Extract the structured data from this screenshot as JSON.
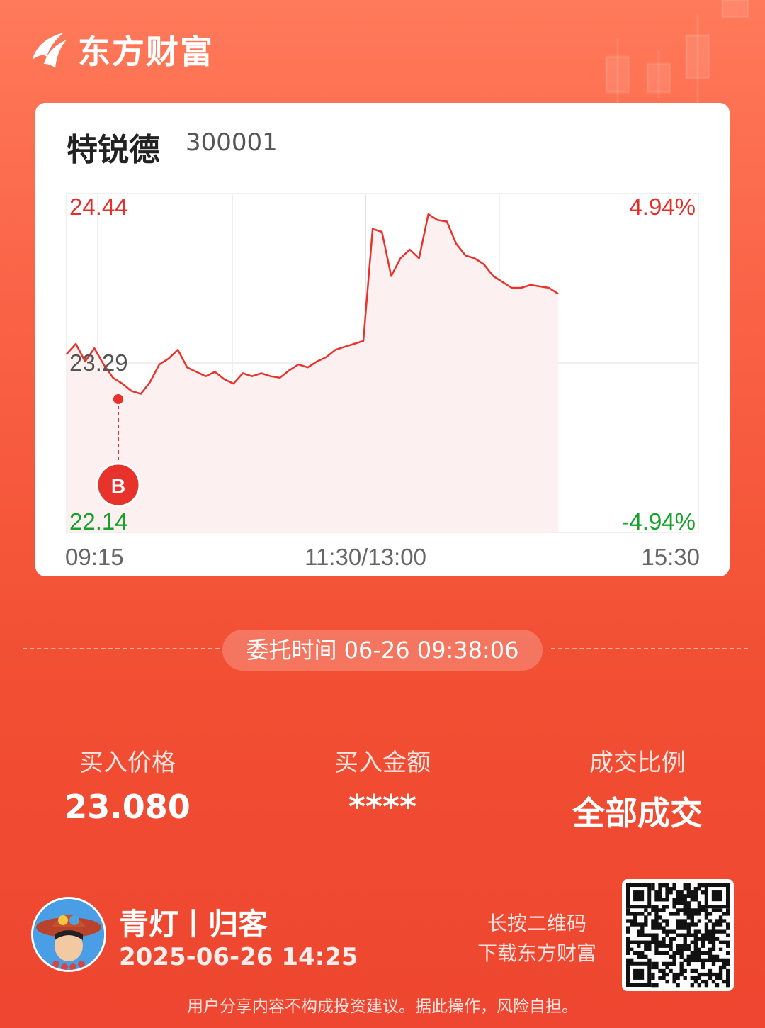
{
  "brand": {
    "name": "东方财富"
  },
  "stock": {
    "name": "特锐德",
    "code": "300001"
  },
  "chart": {
    "price_high": "24.44",
    "price_mid": "23.29",
    "price_low": "22.14",
    "pct_high": "4.94%",
    "pct_low": "-4.94%",
    "time_start": "09:15",
    "time_mid": "11:30/13:00",
    "time_end": "15:30",
    "buy_marker": "B",
    "colors": {
      "line": "#e8332c",
      "up": "#e3302a",
      "down": "#17a12a",
      "fill": "#fdeeee"
    }
  },
  "chart_data": {
    "type": "line",
    "title": "",
    "xlabel": "",
    "ylabel": "",
    "x_ticks": [
      "09:15",
      "11:30/13:00",
      "15:30"
    ],
    "ylim": [
      22.14,
      24.44
    ],
    "y_ticks": [
      22.14,
      23.29,
      24.44
    ],
    "series": [
      {
        "values": [
          23.35,
          23.42,
          23.3,
          23.39,
          23.28,
          23.19,
          23.15,
          23.1,
          23.08,
          23.16,
          23.28,
          23.32,
          23.38,
          23.26,
          23.23,
          23.2,
          23.23,
          23.18,
          23.15,
          23.22,
          23.2,
          23.22,
          23.2,
          23.19,
          23.24,
          23.28,
          23.26,
          23.3,
          23.33,
          23.38,
          23.4,
          23.42,
          23.44,
          24.2,
          24.18,
          23.88,
          24.0,
          24.06,
          24.0,
          24.3,
          24.26,
          24.25,
          24.1,
          24.02,
          24.0,
          23.96,
          23.88,
          23.84,
          23.8,
          23.8,
          23.82,
          23.81,
          23.8,
          23.76
        ]
      }
    ],
    "markers": [
      {
        "label": "B",
        "time": "09:38",
        "price": 23.08
      }
    ]
  },
  "order": {
    "time_label": "委托时间 06-26 09:38:06"
  },
  "stats": [
    {
      "label": "买入价格",
      "value": "23.080"
    },
    {
      "label": "买入金额",
      "value": "****"
    },
    {
      "label": "成交比例",
      "value": "全部成交"
    }
  ],
  "user": {
    "name": "青灯丨归客",
    "time": "2025-06-26 14:25"
  },
  "qr": {
    "hint_line1": "长按二维码",
    "hint_line2": "下载东方财富"
  },
  "footer": {
    "disclaimer": "用户分享内容不构成投资建议。据此操作，风险自担。"
  }
}
